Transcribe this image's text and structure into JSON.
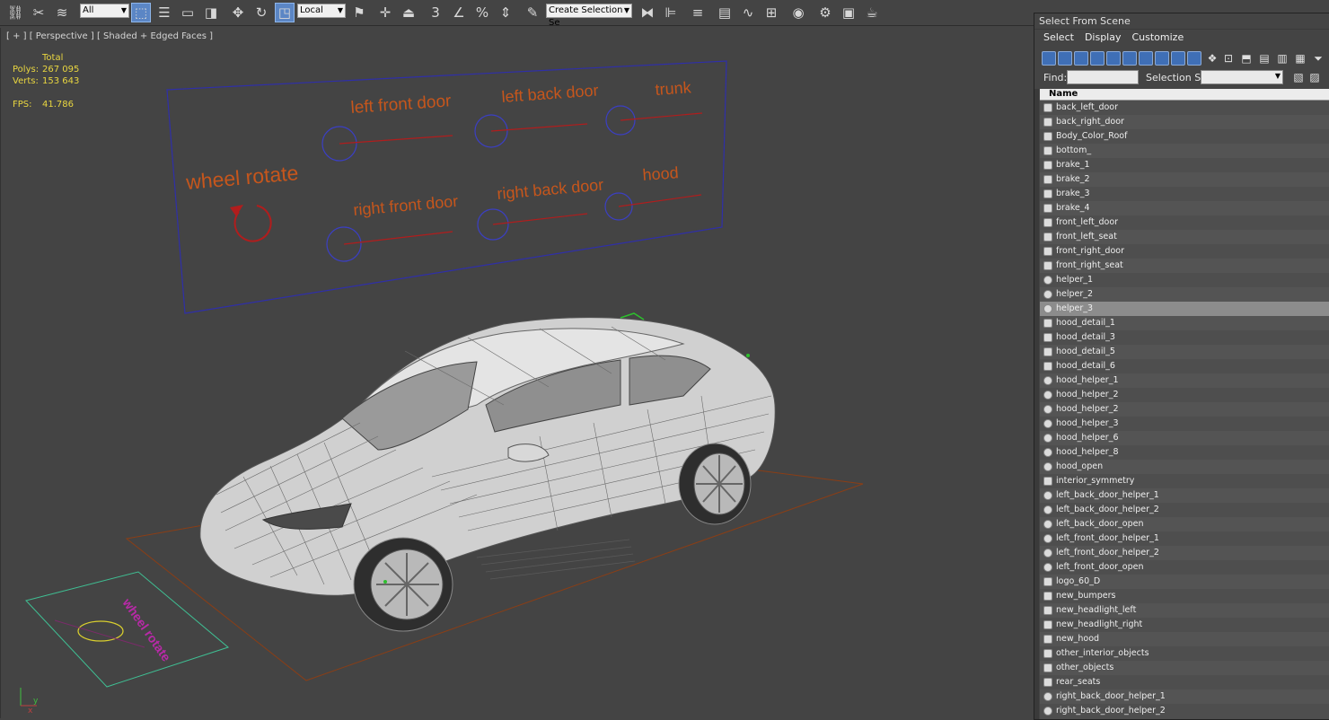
{
  "toolbar": {
    "filter_value": "All",
    "coord_value": "Local",
    "selection_set_placeholder": "Create Selection Se",
    "snap_label": "3",
    "icons": [
      "link-icon",
      "unlink-icon",
      "bind-icon",
      "select-icon",
      "select-by-name-icon",
      "rect-region-icon",
      "window-crossing-icon",
      "move-icon",
      "rotate-icon",
      "scale-icon",
      "pivot-icon",
      "select-manipulate-icon",
      "keyboard-shortcut-icon",
      "snap-icon",
      "angle-snap-icon",
      "percent-snap-icon",
      "spinner-snap-icon",
      "edit-named-sets-icon",
      "mirror-icon",
      "align-icon",
      "layer-icon",
      "scene-explorer-icon",
      "curve-editor-icon",
      "schematic-icon",
      "material-editor-icon",
      "render-setup-icon",
      "render-frame-icon",
      "render-icon"
    ]
  },
  "viewport": {
    "label": "[ + ] [ Perspective ] [ Shaded + Edged Faces ]",
    "stats": {
      "total_label": "Total",
      "polys_label": "Polys:",
      "polys_value": "267 095",
      "verts_label": "Verts:",
      "verts_value": "153 643",
      "fps_label": "FPS:",
      "fps_value": "41.786"
    },
    "panel_labels": {
      "left_front_door": "left front door",
      "left_back_door": "left back door",
      "trunk": "trunk",
      "wheel_rotate": "wheel rotate",
      "right_front_door": "right front door",
      "right_back_door": "right back door",
      "hood": "hood"
    },
    "axis": {
      "y": "y",
      "x": "x"
    }
  },
  "dialog": {
    "title": "Select From Scene",
    "menu": [
      "Select",
      "Display",
      "Customize"
    ],
    "find_label": "Find:",
    "selection_set_label": "Selection Set:",
    "column_name": "Name",
    "items": [
      {
        "name": "back_left_door",
        "icon": "geometry-icon"
      },
      {
        "name": "back_right_door",
        "icon": "geometry-icon"
      },
      {
        "name": "Body_Color_Roof",
        "icon": "geometry-icon"
      },
      {
        "name": "bottom_",
        "icon": "geometry-icon"
      },
      {
        "name": "brake_1",
        "icon": "geometry-icon"
      },
      {
        "name": "brake_2",
        "icon": "geometry-icon"
      },
      {
        "name": "brake_3",
        "icon": "geometry-icon"
      },
      {
        "name": "brake_4",
        "icon": "geometry-icon"
      },
      {
        "name": "front_left_door",
        "icon": "geometry-icon"
      },
      {
        "name": "front_left_seat",
        "icon": "geometry-icon"
      },
      {
        "name": "front_right_door",
        "icon": "geometry-icon"
      },
      {
        "name": "front_right_seat",
        "icon": "geometry-icon"
      },
      {
        "name": "helper_1",
        "icon": "helper-icon"
      },
      {
        "name": "helper_2",
        "icon": "helper-icon"
      },
      {
        "name": "helper_3",
        "icon": "helper-icon"
      },
      {
        "name": "hood_detail_1",
        "icon": "geometry-icon"
      },
      {
        "name": "hood_detail_3",
        "icon": "geometry-icon"
      },
      {
        "name": "hood_detail_5",
        "icon": "geometry-icon"
      },
      {
        "name": "hood_detail_6",
        "icon": "geometry-icon"
      },
      {
        "name": "hood_helper_1",
        "icon": "helper-icon"
      },
      {
        "name": "hood_helper_2",
        "icon": "helper-icon"
      },
      {
        "name": "hood_helper_2",
        "icon": "helper-icon"
      },
      {
        "name": "hood_helper_3",
        "icon": "helper-icon"
      },
      {
        "name": "hood_helper_6",
        "icon": "helper-icon"
      },
      {
        "name": "hood_helper_8",
        "icon": "helper-icon"
      },
      {
        "name": "hood_open",
        "icon": "helper-icon"
      },
      {
        "name": "interior_symmetry",
        "icon": "geometry-icon"
      },
      {
        "name": "left_back_door_helper_1",
        "icon": "helper-icon"
      },
      {
        "name": "left_back_door_helper_2",
        "icon": "helper-icon"
      },
      {
        "name": "left_back_door_open",
        "icon": "helper-icon"
      },
      {
        "name": "left_front_door_helper_1",
        "icon": "helper-icon"
      },
      {
        "name": "left_front_door_helper_2",
        "icon": "helper-icon"
      },
      {
        "name": "left_front_door_open",
        "icon": "helper-icon"
      },
      {
        "name": "logo_60_D",
        "icon": "geometry-icon"
      },
      {
        "name": "new_bumpers",
        "icon": "geometry-icon"
      },
      {
        "name": "new_headlight_left",
        "icon": "geometry-icon"
      },
      {
        "name": "new_headlight_right",
        "icon": "geometry-icon"
      },
      {
        "name": "new_hood",
        "icon": "geometry-icon"
      },
      {
        "name": "other_interior_objects",
        "icon": "geometry-icon"
      },
      {
        "name": "other_objects",
        "icon": "geometry-icon"
      },
      {
        "name": "rear_seats",
        "icon": "geometry-icon"
      },
      {
        "name": "right_back_door_helper_1",
        "icon": "helper-icon"
      },
      {
        "name": "right_back_door_helper_2",
        "icon": "helper-icon"
      }
    ],
    "selected_item": "helper_3"
  },
  "colors": {
    "viewport_bg": "#444444",
    "label_orange": "#c6561c",
    "line_red": "#b11d1d",
    "circle_blue": "#3b3fc4",
    "stats_yellow": "#e9d640",
    "highlight": "#8c8c8c"
  }
}
